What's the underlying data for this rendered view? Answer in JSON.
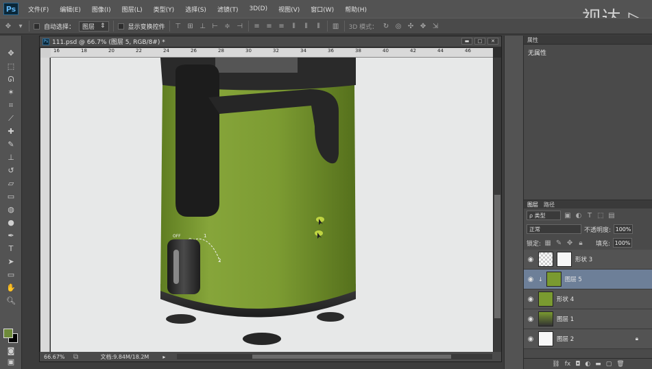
{
  "app": {
    "logo": "Ps",
    "watermark": "视达 ▷"
  },
  "menu": [
    "文件(F)",
    "编辑(E)",
    "图像(I)",
    "图层(L)",
    "类型(Y)",
    "选择(S)",
    "滤镜(T)",
    "3D(D)",
    "视图(V)",
    "窗口(W)",
    "帮助(H)"
  ],
  "options": {
    "auto_select_label": "自动选择：",
    "auto_select_value": "图层",
    "show_transform_label": "显示变换控件",
    "mode_3d_label": "3D 模式："
  },
  "document": {
    "tab_title": "111.psd @ 66.7% (图层 5, RGB/8#) *",
    "ruler_ticks": [
      "16",
      "18",
      "20",
      "22",
      "24",
      "26",
      "28",
      "30",
      "32",
      "34",
      "36",
      "38",
      "40",
      "42",
      "44",
      "46"
    ],
    "zoom": "66.67%",
    "doc_info": "文档:9.84M/18.2M"
  },
  "properties": {
    "tab": "属性",
    "content": "无属性"
  },
  "layers_panel": {
    "tabs": [
      "图层",
      "路径"
    ],
    "filter_kind": "ρ 类型",
    "blend_mode": "正常",
    "opacity_label": "不透明度:",
    "opacity_value": "100%",
    "lock_label": "锁定:",
    "fill_label": "填充:",
    "fill_value": "100%",
    "layers": [
      {
        "name": "形状 3",
        "thumb": "checker",
        "selected": false
      },
      {
        "name": "图层 5",
        "thumb": "green",
        "selected": true
      },
      {
        "name": "形状 4",
        "thumb": "green",
        "selected": false
      },
      {
        "name": "图层 1",
        "thumb": "dark",
        "selected": false
      },
      {
        "name": "图层 2",
        "thumb": "white",
        "selected": false
      }
    ]
  },
  "colors": {
    "foreground": "#6e8a3a",
    "background": "#000000",
    "product_body": "#7a9a30"
  },
  "canvas_labels": {
    "dial_0": "0",
    "dial_1": "1",
    "dial_2": "2",
    "dial_off": "OFF"
  }
}
